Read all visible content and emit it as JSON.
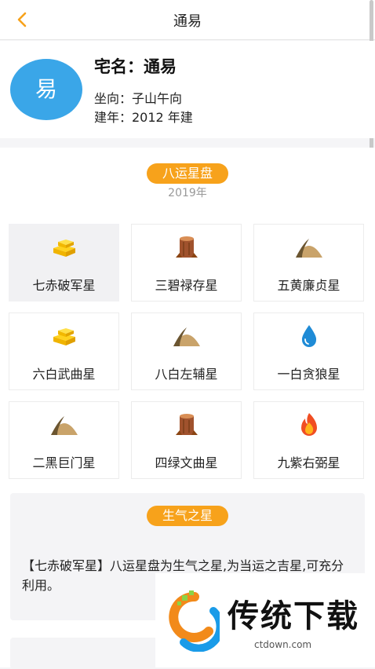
{
  "header": {
    "title": "通易",
    "back_icon": "chevron-left-icon"
  },
  "house": {
    "avatar_text": "易",
    "name_line": "宅名：通易",
    "direction_line": "坐向：子山午向",
    "year_line": "建年：2012 年建"
  },
  "panel": {
    "title": "八运星盘",
    "year": "2019年"
  },
  "stars": [
    {
      "label": "七赤破军星",
      "icon": "gold-bars-icon",
      "selected": true
    },
    {
      "label": "三碧禄存星",
      "icon": "wood-stump-icon",
      "selected": false
    },
    {
      "label": "五黄廉贞星",
      "icon": "earth-mound-icon",
      "selected": false
    },
    {
      "label": "六白武曲星",
      "icon": "gold-bars-icon",
      "selected": false
    },
    {
      "label": "八白左辅星",
      "icon": "earth-mound-icon",
      "selected": false
    },
    {
      "label": "一白贪狼星",
      "icon": "water-drop-icon",
      "selected": false
    },
    {
      "label": "二黑巨门星",
      "icon": "earth-mound-icon",
      "selected": false
    },
    {
      "label": "四绿文曲星",
      "icon": "wood-stump-icon",
      "selected": false
    },
    {
      "label": "九紫右弼星",
      "icon": "fire-icon",
      "selected": false
    }
  ],
  "detail": {
    "badge": "生气之星",
    "text": "【七赤破军星】八运星盘为生气之星,为当运之吉星,可充分利用。"
  },
  "watermark": {
    "brand": "传统下载",
    "url": "ctdown.com"
  },
  "colors": {
    "accent": "#f7a21b",
    "avatar": "#3aa6e8",
    "back": "#f7a21b"
  }
}
